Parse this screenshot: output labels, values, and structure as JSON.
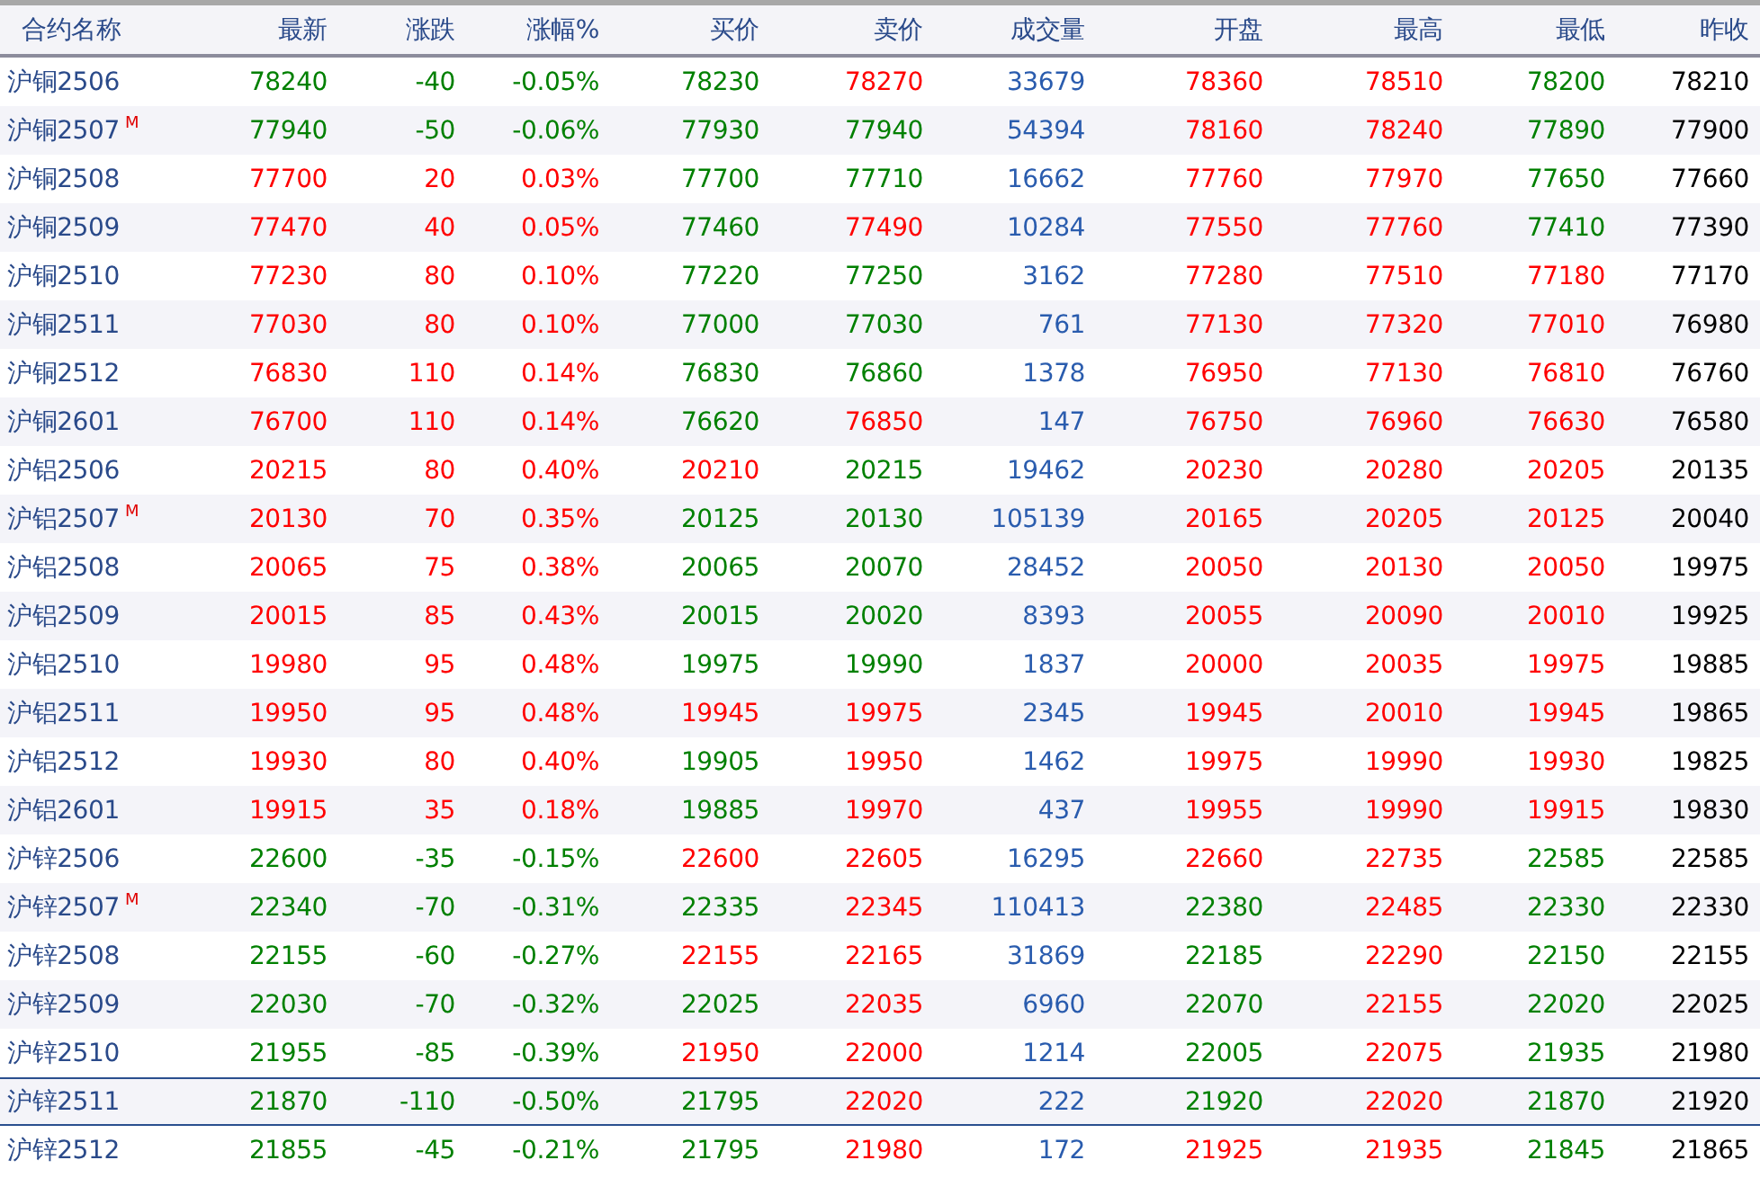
{
  "columns": [
    {
      "label": "合约名称",
      "kind": "name"
    },
    {
      "label": "最新",
      "kind": "price"
    },
    {
      "label": "涨跌",
      "kind": "price"
    },
    {
      "label": "涨幅%",
      "kind": "price"
    },
    {
      "label": "买价",
      "kind": "price"
    },
    {
      "label": "卖价",
      "kind": "price"
    },
    {
      "label": "成交量",
      "kind": "volume"
    },
    {
      "label": "开盘",
      "kind": "price"
    },
    {
      "label": "最高",
      "kind": "price"
    },
    {
      "label": "最低",
      "kind": "price"
    },
    {
      "label": "昨收",
      "kind": "close"
    }
  ],
  "rows": [
    {
      "name": "沪铜2506",
      "selected": false,
      "cells": [
        {
          "value": "78240",
          "up": false
        },
        {
          "value": "-40",
          "up": false
        },
        {
          "value": "-0.05%",
          "up": false
        },
        {
          "value": "78230",
          "up": false
        },
        {
          "value": "78270",
          "up": true
        },
        {
          "value": "33679"
        },
        {
          "value": "78360",
          "up": true
        },
        {
          "value": "78510",
          "up": true
        },
        {
          "value": "78200",
          "up": false
        },
        {
          "value": "78210"
        }
      ]
    },
    {
      "name": "沪铜2507",
      "tag": "M",
      "selected": false,
      "cells": [
        {
          "value": "77940",
          "up": false
        },
        {
          "value": "-50",
          "up": false
        },
        {
          "value": "-0.06%",
          "up": false
        },
        {
          "value": "77930",
          "up": false
        },
        {
          "value": "77940",
          "up": false
        },
        {
          "value": "54394"
        },
        {
          "value": "78160",
          "up": true
        },
        {
          "value": "78240",
          "up": true
        },
        {
          "value": "77890",
          "up": false
        },
        {
          "value": "77900"
        }
      ]
    },
    {
      "name": "沪铜2508",
      "selected": false,
      "cells": [
        {
          "value": "77700",
          "up": true
        },
        {
          "value": "20",
          "up": true
        },
        {
          "value": "0.03%",
          "up": true
        },
        {
          "value": "77700",
          "up": false
        },
        {
          "value": "77710",
          "up": false
        },
        {
          "value": "16662"
        },
        {
          "value": "77760",
          "up": true
        },
        {
          "value": "77970",
          "up": true
        },
        {
          "value": "77650",
          "up": false
        },
        {
          "value": "77660"
        }
      ]
    },
    {
      "name": "沪铜2509",
      "selected": false,
      "cells": [
        {
          "value": "77470",
          "up": true
        },
        {
          "value": "40",
          "up": true
        },
        {
          "value": "0.05%",
          "up": true
        },
        {
          "value": "77460",
          "up": false
        },
        {
          "value": "77490",
          "up": true
        },
        {
          "value": "10284"
        },
        {
          "value": "77550",
          "up": true
        },
        {
          "value": "77760",
          "up": true
        },
        {
          "value": "77410",
          "up": false
        },
        {
          "value": "77390"
        }
      ]
    },
    {
      "name": "沪铜2510",
      "selected": false,
      "cells": [
        {
          "value": "77230",
          "up": true
        },
        {
          "value": "80",
          "up": true
        },
        {
          "value": "0.10%",
          "up": true
        },
        {
          "value": "77220",
          "up": false
        },
        {
          "value": "77250",
          "up": false
        },
        {
          "value": "3162"
        },
        {
          "value": "77280",
          "up": true
        },
        {
          "value": "77510",
          "up": true
        },
        {
          "value": "77180",
          "up": true
        },
        {
          "value": "77170"
        }
      ]
    },
    {
      "name": "沪铜2511",
      "selected": false,
      "cells": [
        {
          "value": "77030",
          "up": true
        },
        {
          "value": "80",
          "up": true
        },
        {
          "value": "0.10%",
          "up": true
        },
        {
          "value": "77000",
          "up": false
        },
        {
          "value": "77030",
          "up": false
        },
        {
          "value": "761"
        },
        {
          "value": "77130",
          "up": true
        },
        {
          "value": "77320",
          "up": true
        },
        {
          "value": "77010",
          "up": true
        },
        {
          "value": "76980"
        }
      ]
    },
    {
      "name": "沪铜2512",
      "selected": false,
      "cells": [
        {
          "value": "76830",
          "up": true
        },
        {
          "value": "110",
          "up": true
        },
        {
          "value": "0.14%",
          "up": true
        },
        {
          "value": "76830",
          "up": false
        },
        {
          "value": "76860",
          "up": false
        },
        {
          "value": "1378"
        },
        {
          "value": "76950",
          "up": true
        },
        {
          "value": "77130",
          "up": true
        },
        {
          "value": "76810",
          "up": true
        },
        {
          "value": "76760"
        }
      ]
    },
    {
      "name": "沪铜2601",
      "selected": false,
      "cells": [
        {
          "value": "76700",
          "up": true
        },
        {
          "value": "110",
          "up": true
        },
        {
          "value": "0.14%",
          "up": true
        },
        {
          "value": "76620",
          "up": false
        },
        {
          "value": "76850",
          "up": true
        },
        {
          "value": "147"
        },
        {
          "value": "76750",
          "up": true
        },
        {
          "value": "76960",
          "up": true
        },
        {
          "value": "76630",
          "up": true
        },
        {
          "value": "76580"
        }
      ]
    },
    {
      "name": "沪铝2506",
      "selected": false,
      "cells": [
        {
          "value": "20215",
          "up": true
        },
        {
          "value": "80",
          "up": true
        },
        {
          "value": "0.40%",
          "up": true
        },
        {
          "value": "20210",
          "up": true
        },
        {
          "value": "20215",
          "up": false
        },
        {
          "value": "19462"
        },
        {
          "value": "20230",
          "up": true
        },
        {
          "value": "20280",
          "up": true
        },
        {
          "value": "20205",
          "up": true
        },
        {
          "value": "20135"
        }
      ]
    },
    {
      "name": "沪铝2507",
      "tag": "M",
      "selected": false,
      "cells": [
        {
          "value": "20130",
          "up": true
        },
        {
          "value": "70",
          "up": true
        },
        {
          "value": "0.35%",
          "up": true
        },
        {
          "value": "20125",
          "up": false
        },
        {
          "value": "20130",
          "up": false
        },
        {
          "value": "105139"
        },
        {
          "value": "20165",
          "up": true
        },
        {
          "value": "20205",
          "up": true
        },
        {
          "value": "20125",
          "up": true
        },
        {
          "value": "20040"
        }
      ]
    },
    {
      "name": "沪铝2508",
      "selected": false,
      "cells": [
        {
          "value": "20065",
          "up": true
        },
        {
          "value": "75",
          "up": true
        },
        {
          "value": "0.38%",
          "up": true
        },
        {
          "value": "20065",
          "up": false
        },
        {
          "value": "20070",
          "up": false
        },
        {
          "value": "28452"
        },
        {
          "value": "20050",
          "up": true
        },
        {
          "value": "20130",
          "up": true
        },
        {
          "value": "20050",
          "up": true
        },
        {
          "value": "19975"
        }
      ]
    },
    {
      "name": "沪铝2509",
      "selected": false,
      "cells": [
        {
          "value": "20015",
          "up": true
        },
        {
          "value": "85",
          "up": true
        },
        {
          "value": "0.43%",
          "up": true
        },
        {
          "value": "20015",
          "up": false
        },
        {
          "value": "20020",
          "up": false
        },
        {
          "value": "8393"
        },
        {
          "value": "20055",
          "up": true
        },
        {
          "value": "20090",
          "up": true
        },
        {
          "value": "20010",
          "up": true
        },
        {
          "value": "19925"
        }
      ]
    },
    {
      "name": "沪铝2510",
      "selected": false,
      "cells": [
        {
          "value": "19980",
          "up": true
        },
        {
          "value": "95",
          "up": true
        },
        {
          "value": "0.48%",
          "up": true
        },
        {
          "value": "19975",
          "up": false
        },
        {
          "value": "19990",
          "up": false
        },
        {
          "value": "1837"
        },
        {
          "value": "20000",
          "up": true
        },
        {
          "value": "20035",
          "up": true
        },
        {
          "value": "19975",
          "up": true
        },
        {
          "value": "19885"
        }
      ]
    },
    {
      "name": "沪铝2511",
      "selected": false,
      "cells": [
        {
          "value": "19950",
          "up": true
        },
        {
          "value": "95",
          "up": true
        },
        {
          "value": "0.48%",
          "up": true
        },
        {
          "value": "19945",
          "up": true
        },
        {
          "value": "19975",
          "up": true
        },
        {
          "value": "2345"
        },
        {
          "value": "19945",
          "up": true
        },
        {
          "value": "20010",
          "up": true
        },
        {
          "value": "19945",
          "up": true
        },
        {
          "value": "19865"
        }
      ]
    },
    {
      "name": "沪铝2512",
      "selected": false,
      "cells": [
        {
          "value": "19930",
          "up": true
        },
        {
          "value": "80",
          "up": true
        },
        {
          "value": "0.40%",
          "up": true
        },
        {
          "value": "19905",
          "up": false
        },
        {
          "value": "19950",
          "up": true
        },
        {
          "value": "1462"
        },
        {
          "value": "19975",
          "up": true
        },
        {
          "value": "19990",
          "up": true
        },
        {
          "value": "19930",
          "up": true
        },
        {
          "value": "19825"
        }
      ]
    },
    {
      "name": "沪铝2601",
      "selected": false,
      "cells": [
        {
          "value": "19915",
          "up": true
        },
        {
          "value": "35",
          "up": true
        },
        {
          "value": "0.18%",
          "up": true
        },
        {
          "value": "19885",
          "up": false
        },
        {
          "value": "19970",
          "up": true
        },
        {
          "value": "437"
        },
        {
          "value": "19955",
          "up": true
        },
        {
          "value": "19990",
          "up": true
        },
        {
          "value": "19915",
          "up": true
        },
        {
          "value": "19830"
        }
      ]
    },
    {
      "name": "沪锌2506",
      "selected": false,
      "cells": [
        {
          "value": "22600",
          "up": false
        },
        {
          "value": "-35",
          "up": false
        },
        {
          "value": "-0.15%",
          "up": false
        },
        {
          "value": "22600",
          "up": true
        },
        {
          "value": "22605",
          "up": true
        },
        {
          "value": "16295"
        },
        {
          "value": "22660",
          "up": true
        },
        {
          "value": "22735",
          "up": true
        },
        {
          "value": "22585",
          "up": false
        },
        {
          "value": "22585"
        }
      ]
    },
    {
      "name": "沪锌2507",
      "tag": "M",
      "selected": false,
      "cells": [
        {
          "value": "22340",
          "up": false
        },
        {
          "value": "-70",
          "up": false
        },
        {
          "value": "-0.31%",
          "up": false
        },
        {
          "value": "22335",
          "up": false
        },
        {
          "value": "22345",
          "up": true
        },
        {
          "value": "110413"
        },
        {
          "value": "22380",
          "up": false
        },
        {
          "value": "22485",
          "up": true
        },
        {
          "value": "22330",
          "up": false
        },
        {
          "value": "22330"
        }
      ]
    },
    {
      "name": "沪锌2508",
      "selected": false,
      "cells": [
        {
          "value": "22155",
          "up": false
        },
        {
          "value": "-60",
          "up": false
        },
        {
          "value": "-0.27%",
          "up": false
        },
        {
          "value": "22155",
          "up": true
        },
        {
          "value": "22165",
          "up": true
        },
        {
          "value": "31869"
        },
        {
          "value": "22185",
          "up": false
        },
        {
          "value": "22290",
          "up": true
        },
        {
          "value": "22150",
          "up": false
        },
        {
          "value": "22155"
        }
      ]
    },
    {
      "name": "沪锌2509",
      "selected": false,
      "cells": [
        {
          "value": "22030",
          "up": false
        },
        {
          "value": "-70",
          "up": false
        },
        {
          "value": "-0.32%",
          "up": false
        },
        {
          "value": "22025",
          "up": false
        },
        {
          "value": "22035",
          "up": true
        },
        {
          "value": "6960"
        },
        {
          "value": "22070",
          "up": false
        },
        {
          "value": "22155",
          "up": true
        },
        {
          "value": "22020",
          "up": false
        },
        {
          "value": "22025"
        }
      ]
    },
    {
      "name": "沪锌2510",
      "selected": false,
      "cells": [
        {
          "value": "21955",
          "up": false
        },
        {
          "value": "-85",
          "up": false
        },
        {
          "value": "-0.39%",
          "up": false
        },
        {
          "value": "21950",
          "up": true
        },
        {
          "value": "22000",
          "up": true
        },
        {
          "value": "1214"
        },
        {
          "value": "22005",
          "up": false
        },
        {
          "value": "22075",
          "up": true
        },
        {
          "value": "21935",
          "up": false
        },
        {
          "value": "21980"
        }
      ]
    },
    {
      "name": "沪锌2511",
      "selected": true,
      "cells": [
        {
          "value": "21870",
          "up": false
        },
        {
          "value": "-110",
          "up": false
        },
        {
          "value": "-0.50%",
          "up": false
        },
        {
          "value": "21795",
          "up": false
        },
        {
          "value": "22020",
          "up": true
        },
        {
          "value": "222"
        },
        {
          "value": "21920",
          "up": false
        },
        {
          "value": "22020",
          "up": true
        },
        {
          "value": "21870",
          "up": false
        },
        {
          "value": "21920"
        }
      ]
    },
    {
      "name": "沪锌2512",
      "selected": false,
      "cells": [
        {
          "value": "21855",
          "up": false
        },
        {
          "value": "-45",
          "up": false
        },
        {
          "value": "-0.21%",
          "up": false
        },
        {
          "value": "21795",
          "up": false
        },
        {
          "value": "21980",
          "up": true
        },
        {
          "value": "172"
        },
        {
          "value": "21925",
          "up": true
        },
        {
          "value": "21935",
          "up": true
        },
        {
          "value": "21845",
          "up": false
        },
        {
          "value": "21865"
        }
      ]
    }
  ]
}
